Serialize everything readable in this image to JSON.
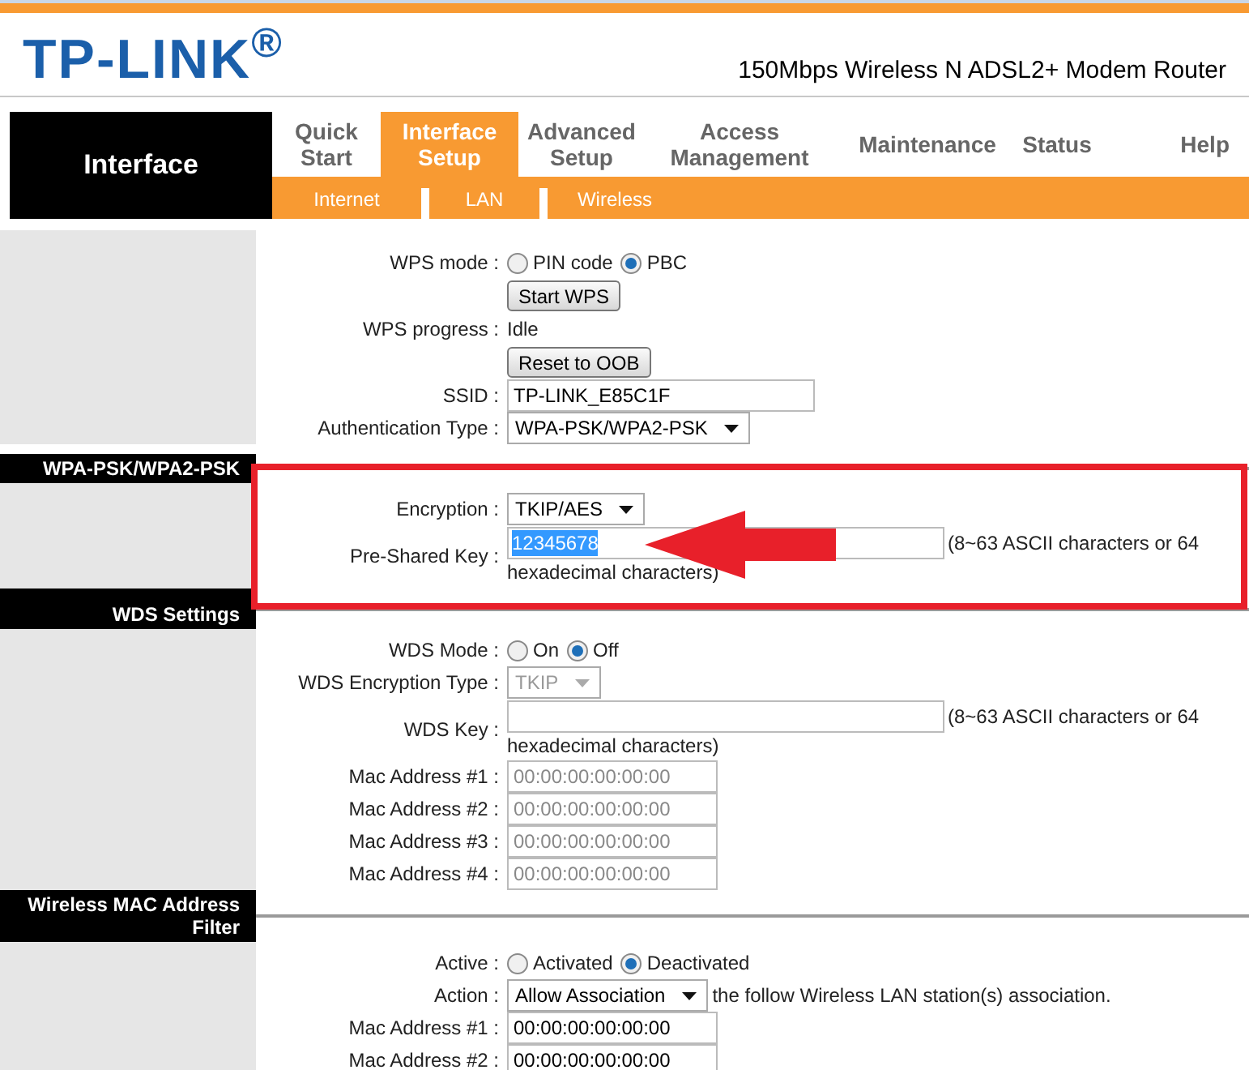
{
  "header": {
    "logo": "TP-LINK$^{®}$",
    "product": "150Mbps Wireless N ADSL2+ Modem Router"
  },
  "nav": {
    "section": "Interface",
    "tabs": [
      {
        "label": "Quick Start",
        "selected": false
      },
      {
        "label": "Interface Setup",
        "selected": true
      },
      {
        "label": "Advanced Setup",
        "selected": false
      },
      {
        "label": "Access Management",
        "selected": false
      },
      {
        "label": "Maintenance",
        "selected": false
      },
      {
        "label": "Status",
        "selected": false
      },
      {
        "label": "Help",
        "selected": false
      }
    ],
    "subtabs": [
      "Internet",
      "LAN",
      "Wireless"
    ]
  },
  "sections": [
    {
      "rows": [
        {
          "kind": "radio",
          "label": "WPS mode :",
          "options": [
            {
              "label": "PIN code",
              "selected": false
            },
            {
              "label": "PBC",
              "selected": true
            }
          ]
        },
        {
          "kind": "button",
          "button": "Start WPS"
        },
        {
          "kind": "text",
          "label": "WPS progress :",
          "value": "Idle"
        },
        {
          "kind": "button",
          "button": "Reset to OOB"
        },
        {
          "kind": "input",
          "label": "SSID :",
          "value": "TP-LINK_E85C1F"
        },
        {
          "kind": "select",
          "label": "Authentication Type :",
          "value": "WPA-PSK/WPA2-PSK",
          "disabled": false
        }
      ]
    },
    {
      "title": "WPA-PSK/WPA2-PSK",
      "rows": [
        {
          "kind": "select",
          "label": "Encryption :",
          "value": "TKIP/AES",
          "disabled": false
        },
        {
          "kind": "key",
          "label": "Pre-Shared Key :",
          "value": "12345678",
          "highlighted": true,
          "hint": [
            "(8~63 ASCII characters or 64",
            "hexadecimal characters)"
          ]
        }
      ]
    },
    {
      "title": "WDS Settings",
      "rows": [
        {
          "kind": "radio",
          "label": "WDS Mode :",
          "options": [
            {
              "label": "On",
              "selected": false
            },
            {
              "label": "Off",
              "selected": true
            }
          ]
        },
        {
          "kind": "select",
          "label": "WDS Encryption Type :",
          "value": "TKIP",
          "disabled": true
        },
        {
          "kind": "key",
          "label": "WDS Key :",
          "hint": [
            "(8~63 ASCII characters or 64",
            "hexadecimal characters)"
          ]
        },
        {
          "kind": "mac",
          "label": "Mac Address #1 :",
          "value": "00:00:00:00:00:00",
          "disabled": true
        },
        {
          "kind": "mac",
          "label": "Mac Address #2 :",
          "value": "00:00:00:00:00:00",
          "disabled": true
        },
        {
          "kind": "mac",
          "label": "Mac Address #3 :",
          "value": "00:00:00:00:00:00",
          "disabled": true
        },
        {
          "kind": "mac",
          "label": "Mac Address #4 :",
          "value": "00:00:00:00:00:00",
          "disabled": true
        }
      ]
    },
    {
      "title": "Wireless MAC Address Filter",
      "rows": [
        {
          "kind": "radio",
          "label": "Active :",
          "options": [
            {
              "label": "Activated",
              "selected": false
            },
            {
              "label": "Deactivated",
              "selected": true
            }
          ]
        },
        {
          "kind": "select",
          "label": "Action :",
          "value": "Allow Association",
          "disabled": false,
          "after": "the follow Wireless LAN station(s) association."
        },
        {
          "kind": "mac",
          "label": "Mac Address #1 :",
          "value": "00:00:00:00:00:00",
          "disabled": false
        },
        {
          "kind": "mac",
          "label": "Mac Address #2 :",
          "value": "00:00:00:00:00:00",
          "disabled": false
        }
      ]
    }
  ],
  "annotation": {
    "frame": true,
    "arrow": true
  }
}
